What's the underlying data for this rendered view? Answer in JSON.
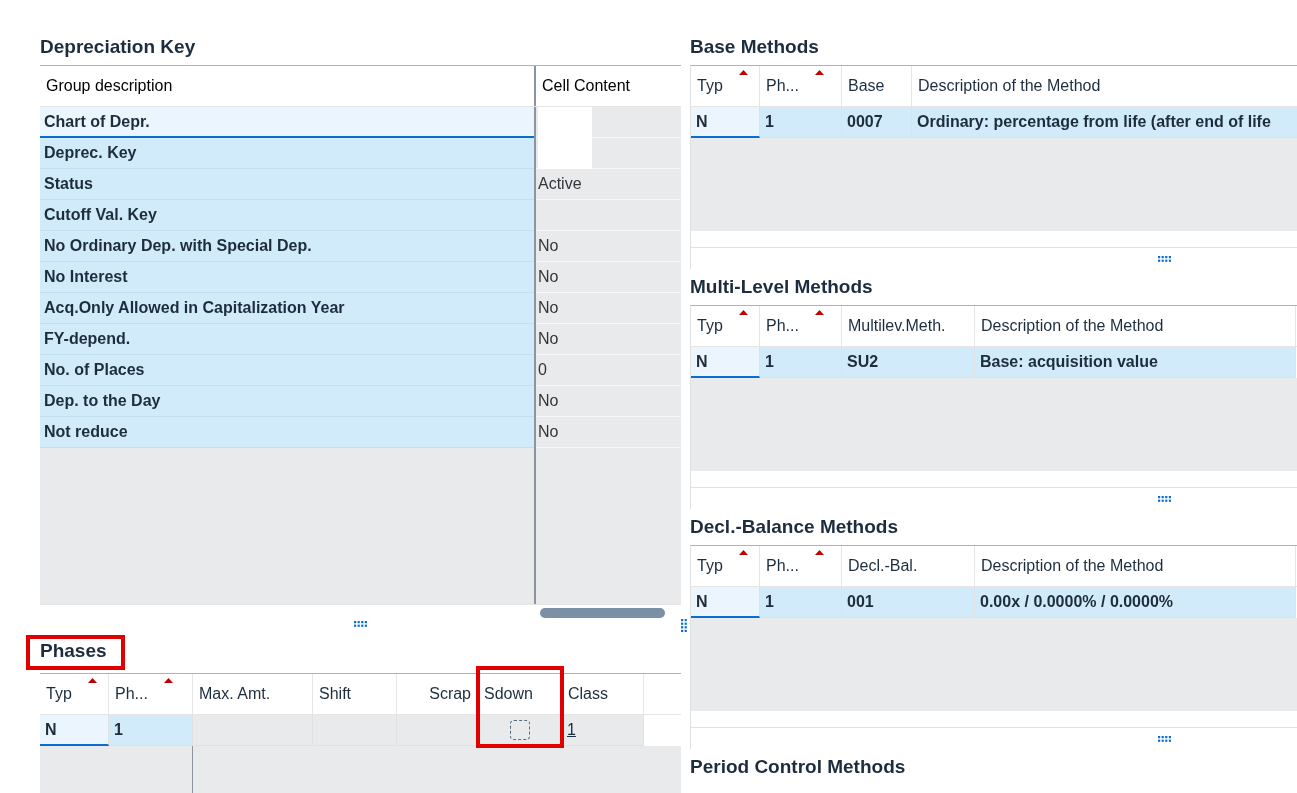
{
  "depreciation_key": {
    "title": "Depreciation Key",
    "columns": [
      "Group description",
      "Cell Content"
    ],
    "rows": [
      {
        "label": "Chart of Depr.",
        "focused": true,
        "field_shown": true
      },
      {
        "label": "Deprec. Key",
        "focused": false,
        "field_shown": true
      },
      {
        "label": "Status",
        "focused": false,
        "field_shown": false,
        "content": "Active"
      },
      {
        "label": "Cutoff Val. Key",
        "focused": false,
        "field_shown": false
      },
      {
        "label": "No Ordinary Dep. with Special Dep.",
        "focused": false,
        "field_shown": false,
        "content": "No"
      },
      {
        "label": "No Interest",
        "focused": false,
        "field_shown": false,
        "content": "No"
      },
      {
        "label": "Acq.Only Allowed in Capitalization Year",
        "focused": false,
        "field_shown": false,
        "content": "No"
      },
      {
        "label": "FY-depend.",
        "focused": false,
        "field_shown": false,
        "content": "No"
      },
      {
        "label": "No. of Places",
        "focused": false,
        "field_shown": false,
        "content": "0"
      },
      {
        "label": "Dep. to the Day",
        "focused": false,
        "field_shown": false,
        "content": "No"
      },
      {
        "label": "Not reduce",
        "focused": false,
        "field_shown": false,
        "content": "No"
      }
    ]
  },
  "phases": {
    "title": "Phases",
    "highlighted": true,
    "columns": [
      {
        "label": "Typ",
        "sorted": true,
        "highlighted": false
      },
      {
        "label": "Ph...",
        "sorted": true,
        "highlighted": false
      },
      {
        "label": "Max. Amt.",
        "sorted": false,
        "highlighted": false
      },
      {
        "label": "Shift",
        "sorted": false,
        "highlighted": false
      },
      {
        "label": "Scrap",
        "sorted": false,
        "highlighted": false
      },
      {
        "label": "Sdown",
        "sorted": false,
        "highlighted": true
      },
      {
        "label": "Class",
        "sorted": false,
        "highlighted": false
      }
    ],
    "rows": [
      {
        "cells": [
          {
            "kind": "key",
            "text": "N",
            "focused": true,
            "selected": true
          },
          {
            "kind": "key",
            "text": "1",
            "focused": false,
            "selected": true
          },
          {
            "kind": "text",
            "focused": false,
            "selected": false
          },
          {
            "kind": "text",
            "focused": false,
            "selected": false
          },
          {
            "kind": "text",
            "focused": false,
            "selected": false
          },
          {
            "kind": "checkbox",
            "checked": false,
            "focused": false,
            "selected": false
          },
          {
            "kind": "link",
            "text": "1",
            "focused": false,
            "selected": false
          }
        ]
      }
    ]
  },
  "method_sections": [
    {
      "title": "Base Methods",
      "columns": [
        {
          "label": "Typ",
          "sorted": true
        },
        {
          "label": "Ph...",
          "sorted": true
        },
        {
          "label": "Base",
          "sorted": false
        },
        {
          "label": "Description of the Method",
          "sorted": false
        }
      ],
      "rows": [
        {
          "cells": [
            {
              "kind": "key",
              "text": "N",
              "focused": true,
              "selected": true
            },
            {
              "kind": "key",
              "text": "1",
              "focused": false,
              "selected": true
            },
            {
              "kind": "key",
              "text": "0007",
              "focused": false,
              "selected": true
            },
            {
              "kind": "key",
              "text": "Ordinary: percentage from life (after end of life",
              "focused": false,
              "selected": true
            }
          ]
        }
      ]
    },
    {
      "title": "Multi-Level Methods",
      "columns": [
        {
          "label": "Typ",
          "sorted": true
        },
        {
          "label": "Ph...",
          "sorted": true
        },
        {
          "label": "Multilev.Meth.",
          "sorted": false
        },
        {
          "label": "Description of the Method",
          "sorted": false
        }
      ],
      "rows": [
        {
          "cells": [
            {
              "kind": "key",
              "text": "N",
              "focused": true,
              "selected": true
            },
            {
              "kind": "key",
              "text": "1",
              "focused": false,
              "selected": true
            },
            {
              "kind": "key",
              "text": "SU2",
              "focused": false,
              "selected": true
            },
            {
              "kind": "key",
              "text": "Base: acquisition value",
              "focused": false,
              "selected": true
            }
          ]
        }
      ]
    },
    {
      "title": "Decl.-Balance Methods",
      "columns": [
        {
          "label": "Typ",
          "sorted": true
        },
        {
          "label": "Ph...",
          "sorted": true
        },
        {
          "label": "Decl.-Bal.",
          "sorted": false
        },
        {
          "label": "Description of the Method",
          "sorted": false
        }
      ],
      "rows": [
        {
          "cells": [
            {
              "kind": "key",
              "text": "N",
              "focused": true,
              "selected": true
            },
            {
              "kind": "key",
              "text": "1",
              "focused": false,
              "selected": true
            },
            {
              "kind": "key",
              "text": "001",
              "focused": false,
              "selected": true
            },
            {
              "kind": "key",
              "text": "0.00x / 0.0000% / 0.0000%",
              "focused": false,
              "selected": true
            }
          ]
        }
      ]
    },
    {
      "title": "Period Control Methods"
    }
  ]
}
